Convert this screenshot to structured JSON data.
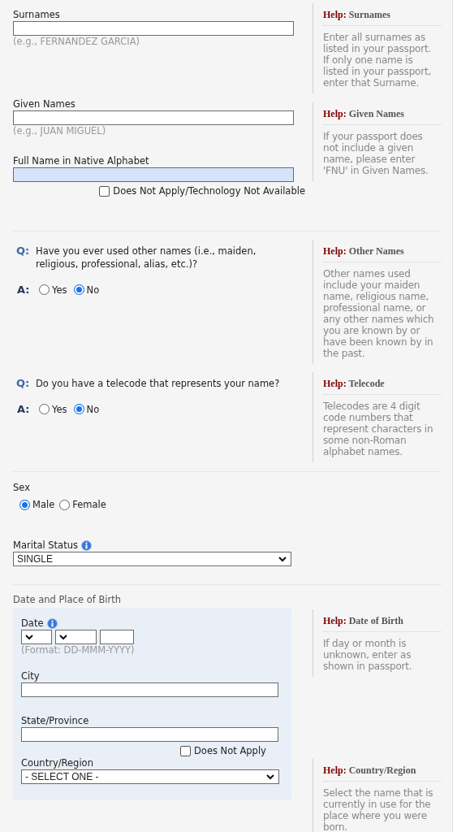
{
  "names": {
    "fields": [
      {
        "label": "Surnames",
        "hint": "(e.g., FERNANDEZ GARCIA)",
        "autofilled": false
      },
      {
        "label": "Given Names",
        "hint": "(e.g., JUAN MIGUEL)",
        "autofilled": false
      },
      {
        "label": "Full Name in Native Alphabet",
        "autofilled": true
      }
    ],
    "checkbox": {
      "label": "Does Not Apply/Technology Not Available",
      "checked": false
    },
    "help": [
      {
        "prefix": "Help:",
        "title": "Surnames",
        "text": "Enter all surnames as listed in your passport. If only one name is listed in your passport, enter that Surname."
      },
      {
        "prefix": "Help:",
        "title": "Given Names",
        "text": "If your passport does not include a given name, please enter 'FNU' in Given Names."
      }
    ]
  },
  "questions": [
    {
      "q_mark": "Q:",
      "question": "Have you ever used other names (i.e., maiden, religious, professional, alias, etc.)?",
      "a_mark": "A:",
      "options": [
        {
          "label": "Yes",
          "selected": false
        },
        {
          "label": "No",
          "selected": true
        }
      ],
      "help": {
        "prefix": "Help:",
        "title": "Other Names",
        "text": "Other names used include your maiden name, religious name, professional name, or any other names which you are known by or have been known by in the past."
      }
    },
    {
      "q_mark": "Q:",
      "question": "Do you have a telecode that represents your name?",
      "a_mark": "A:",
      "options": [
        {
          "label": "Yes",
          "selected": false
        },
        {
          "label": "No",
          "selected": true
        }
      ],
      "help": {
        "prefix": "Help:",
        "title": "Telecode",
        "text": "Telecodes are 4 digit code numbers that represent characters in some non-Roman alphabet names."
      }
    }
  ],
  "sex": {
    "label": "Sex",
    "options": [
      {
        "label": "Male",
        "selected": true
      },
      {
        "label": "Female",
        "selected": false
      }
    ]
  },
  "marital_status": {
    "label": "Marital Status",
    "value": "SINGLE"
  },
  "birth": {
    "heading": "Date and Place of Birth",
    "date_label": "Date",
    "date_format": "(Format: DD-MMM-YYYY)",
    "city_label": "City",
    "state_label": "State/Province",
    "does_not_apply": {
      "label": "Does Not Apply",
      "checked": false
    },
    "country_label": "Country/Region",
    "country_value": "- SELECT ONE -",
    "help": [
      {
        "prefix": "Help:",
        "title": "Date of Birth",
        "text": "If day or month is unknown, enter as shown in passport."
      },
      {
        "prefix": "Help:",
        "title": "Country/Region",
        "text": "Select the name that is currently in use for the place where you were born."
      }
    ]
  }
}
